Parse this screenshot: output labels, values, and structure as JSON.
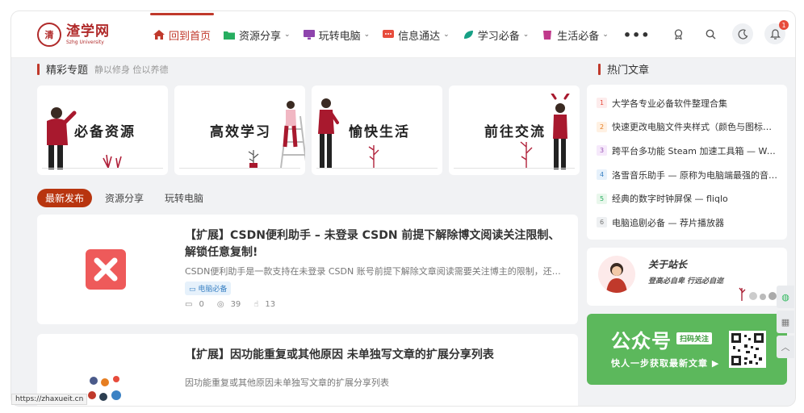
{
  "logo": {
    "seal": "清",
    "name": "渣学网",
    "tagline": "Szhg University"
  },
  "nav": {
    "items": [
      {
        "label": "回到首页",
        "icon": "home-icon",
        "color": "#c0392b",
        "active": true,
        "dropdown": false
      },
      {
        "label": "资源分享",
        "icon": "folder-icon",
        "color": "#27ae60",
        "active": false,
        "dropdown": true
      },
      {
        "label": "玩转电脑",
        "icon": "monitor-icon",
        "color": "#8e44ad",
        "active": false,
        "dropdown": true
      },
      {
        "label": "信息通达",
        "icon": "message-icon",
        "color": "#e74c3c",
        "active": false,
        "dropdown": true
      },
      {
        "label": "学习必备",
        "icon": "leaf-icon",
        "color": "#16a085",
        "active": false,
        "dropdown": true
      },
      {
        "label": "生活必备",
        "icon": "cup-icon",
        "color": "#c0398b",
        "active": false,
        "dropdown": true
      }
    ],
    "more": "•••"
  },
  "header_icons": {
    "badge_count": "1"
  },
  "featured": {
    "title": "精彩专题",
    "subtitle": "静以修身 俭以养德",
    "topics": [
      {
        "label": "必备资源"
      },
      {
        "label": "高效学习"
      },
      {
        "label": "愉快生活"
      },
      {
        "label": "前往交流"
      }
    ]
  },
  "tabs": [
    "最新发布",
    "资源分享",
    "玩转电脑"
  ],
  "posts": [
    {
      "title": "【扩展】CSDN便利助手 – 未登录 CSDN 前提下解除博文阅读关注限制、解锁任意复制!",
      "excerpt": "CSDN便利助手是一款支持在未登录 CSDN 账号前提下解除文章阅读需要关注博主的限制，还…",
      "category": "电脑必备",
      "comments": "0",
      "views": "39",
      "likes": "13"
    },
    {
      "title": "【扩展】因功能重复或其他原因 未单独写文章的扩展分享列表",
      "excerpt": "因功能重复或其他原因未单独写文章的扩展分享列表"
    }
  ],
  "hot": {
    "title": "热门文章",
    "items": [
      {
        "num": "1",
        "text": "大学各专业必备软件整理合集",
        "bg": "#fdecec",
        "fg": "#e74c3c"
      },
      {
        "num": "2",
        "text": "快速更改电脑文件夹样式（颜色与图标…",
        "bg": "#fff1e3",
        "fg": "#e67e22"
      },
      {
        "num": "3",
        "text": "跨平台多功能 Steam 加速工具箱 — Wa…",
        "bg": "#f6e9fb",
        "fg": "#9b59b6"
      },
      {
        "num": "4",
        "text": "洛雪音乐助手 — 原称为电脑端最强的音…",
        "bg": "#e6f1fb",
        "fg": "#3b82c4"
      },
      {
        "num": "5",
        "text": "经典的数字时钟屏保 — fliqlo",
        "bg": "#e9f7ec",
        "fg": "#27ae60"
      },
      {
        "num": "6",
        "text": "电脑追剧必备 — 荐片播放器",
        "bg": "#eef0f2",
        "fg": "#777777"
      }
    ]
  },
  "about": {
    "title": "关于站长",
    "subtitle": "登高必自卑 行远必自迩"
  },
  "wechat": {
    "big": "公众号",
    "tag": "扫码关注",
    "line": "快人一步获取最新文章 ▶"
  },
  "status_url": "https://zhaxueit.cn"
}
